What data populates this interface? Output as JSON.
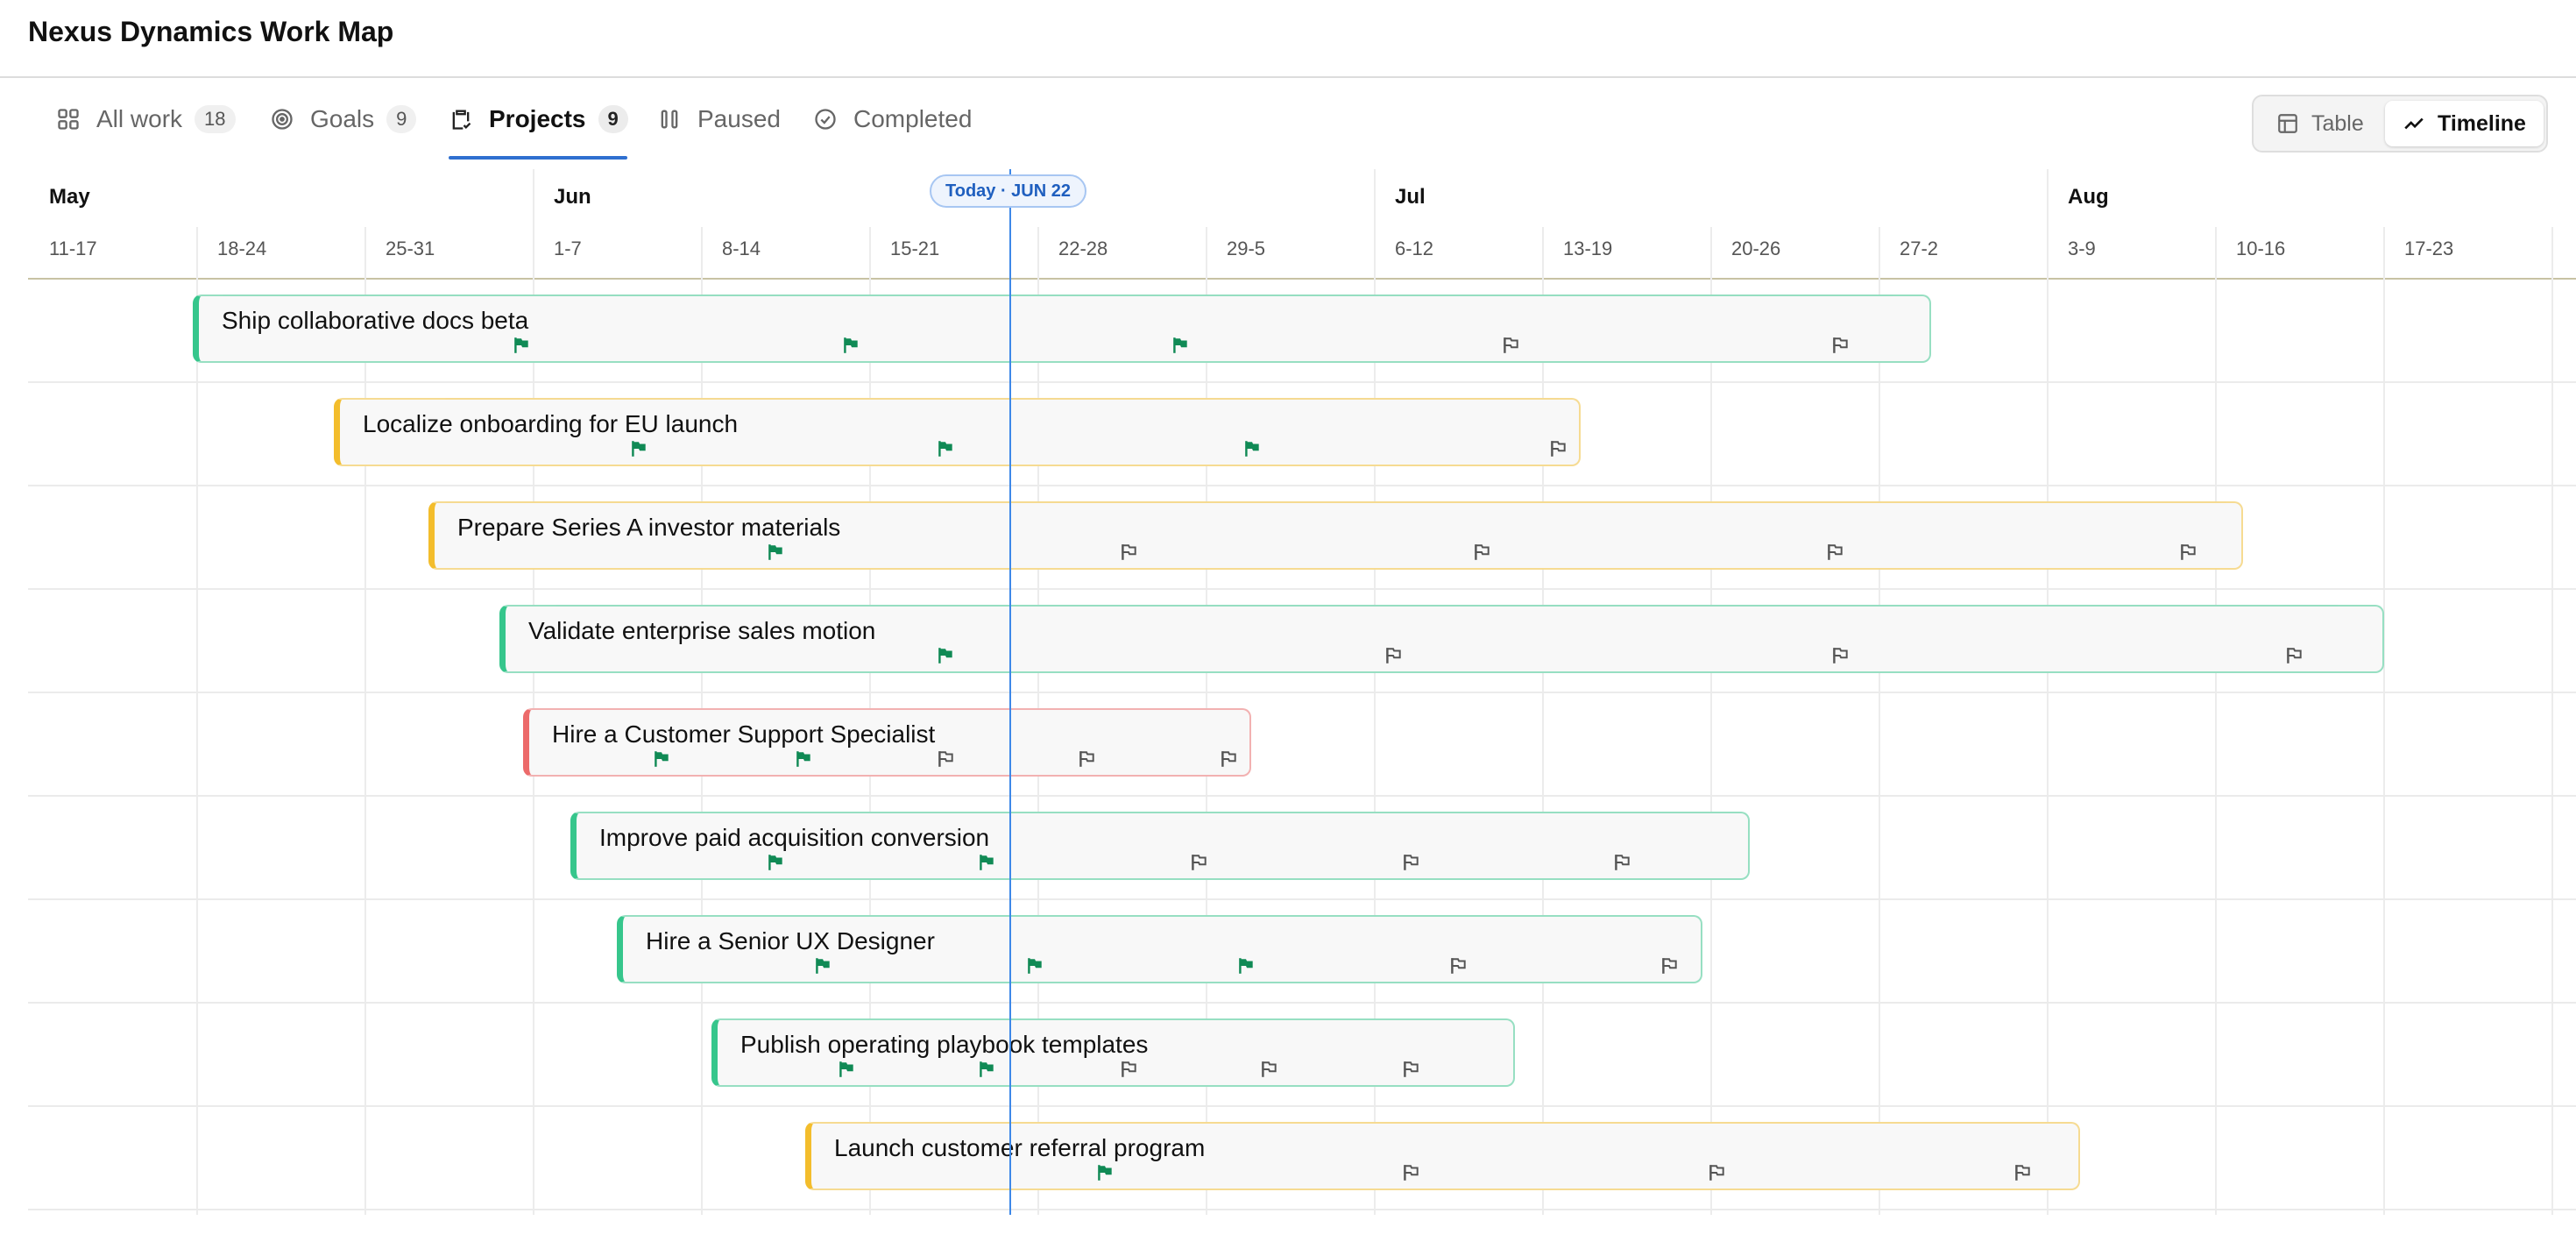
{
  "app": {
    "title": "Nexus Dynamics Work Map"
  },
  "tabs": [
    {
      "key": "all-work",
      "label": "All work",
      "count": "18",
      "icon": "grid-icon",
      "active": false
    },
    {
      "key": "goals",
      "label": "Goals",
      "count": "9",
      "icon": "target-icon",
      "active": false
    },
    {
      "key": "projects",
      "label": "Projects",
      "count": "9",
      "icon": "clipboard-check-icon",
      "active": true
    },
    {
      "key": "paused",
      "label": "Paused",
      "count": "",
      "icon": "pause-icon",
      "active": false
    },
    {
      "key": "completed",
      "label": "Completed",
      "count": "",
      "icon": "check-circle-icon",
      "active": false
    }
  ],
  "view_toggle": {
    "table_label": "Table",
    "timeline_label": "Timeline",
    "active": "timeline"
  },
  "timeline": {
    "today_label": "Today · JUN 22",
    "months": [
      "May",
      "Jun",
      "Jul",
      "Aug"
    ],
    "weeks": [
      "11-17",
      "18-24",
      "25-31",
      "1-7",
      "8-14",
      "15-21",
      "22-28",
      "29-5",
      "6-12",
      "13-19",
      "20-26",
      "27-2",
      "3-9",
      "10-16",
      "17-23"
    ],
    "status_colors": {
      "green": "#36c68c",
      "yellow": "#f3bd2c",
      "red": "#ec6a6a"
    },
    "flag_colors": {
      "done": "#108a55",
      "pending": "#555555"
    },
    "projects": [
      {
        "name": "Ship collaborative docs beta",
        "status": "green",
        "flags": [
          "done",
          "done",
          "done",
          "pending",
          "pending"
        ]
      },
      {
        "name": "Localize onboarding for EU launch",
        "status": "yellow",
        "flags": [
          "done",
          "done",
          "done",
          "pending"
        ]
      },
      {
        "name": "Prepare Series A investor materials",
        "status": "yellow",
        "flags": [
          "done",
          "pending",
          "pending",
          "pending",
          "pending"
        ]
      },
      {
        "name": "Validate enterprise sales motion",
        "status": "green",
        "flags": [
          "done",
          "pending",
          "pending",
          "pending"
        ]
      },
      {
        "name": "Hire a Customer Support Specialist",
        "status": "red",
        "flags": [
          "done",
          "done",
          "pending",
          "pending",
          "pending"
        ]
      },
      {
        "name": "Improve paid acquisition conversion",
        "status": "green",
        "flags": [
          "done",
          "done",
          "pending",
          "pending",
          "pending"
        ]
      },
      {
        "name": "Hire a Senior UX Designer",
        "status": "green",
        "flags": [
          "done",
          "done",
          "done",
          "pending",
          "pending"
        ]
      },
      {
        "name": "Publish operating playbook templates",
        "status": "green",
        "flags": [
          "done",
          "done",
          "pending",
          "pending",
          "pending"
        ]
      },
      {
        "name": "Launch customer referral program",
        "status": "yellow",
        "flags": [
          "done",
          "pending",
          "pending",
          "pending"
        ]
      }
    ]
  }
}
